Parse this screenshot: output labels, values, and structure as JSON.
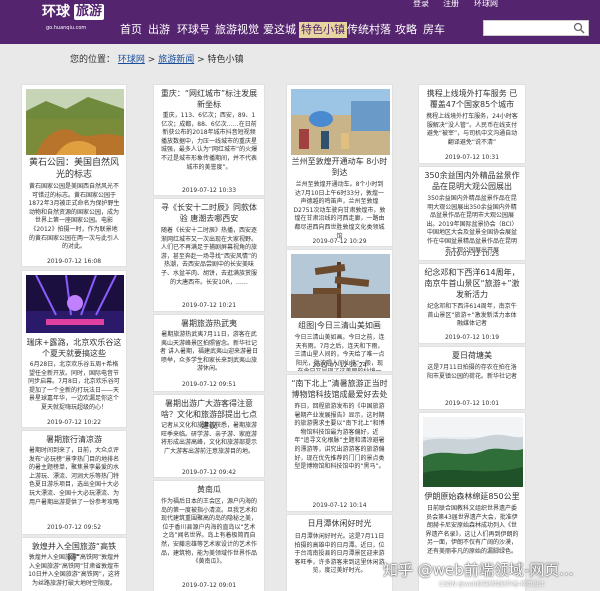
{
  "header": {
    "logo_text_1": "环球",
    "logo_text_2": "旅游",
    "logo_domain": "go.huanqiu.com",
    "user_links": [
      "登录",
      "注册",
      "环球网"
    ],
    "nav": [
      "首页",
      "出游",
      "环球号",
      "旅游视觉",
      "爱这城",
      "特色小镇",
      "传统村落",
      "攻略",
      "房车"
    ],
    "active_nav": "特色小镇",
    "search_value": ""
  },
  "breadcrumb": {
    "prefix": "您的位置：",
    "items": [
      "环球网",
      "旅游新闻",
      "特色小镇"
    ],
    "sep": ">"
  },
  "cards": [
    {
      "title": "黄石公园：美国自然风光的标志",
      "desc": "黄石国家公园是美国西自然风光不可错过的标志。黄石国家公园于1872年3月被正式命名为保护野生动物和自然资源的国家公园，成为世界上第一座国家公园。电影《2012》拍摄一时，作为联景地的黄石国家公园在两一次与此引人的对此。",
      "date": "2019-07-12 16:08"
    },
    {
      "title": "瑞床+露潞，北京欢乐谷这个夏天就要搞这些",
      "desc": "6月28日，北京欢乐谷五周+希格望任全新开放。同时，国际电音节同步启幕。7月8日，北京欢乐谷可提加了一个全新的打玩法日——天景星球嘉年华，一边欢漏足你这个夏天就捉嗨玩超级的心！",
      "date": "2019-07-12 10:22"
    },
    {
      "title": "暑期旅行清凉游",
      "desc": "暑期时间到来了，日前，大众点评发布“必玩榜”景李热门目的地排名的暑主题榜单，聚焦景李最爱的水上游玩、漂流、河涧大乐等热门特色夏日游乐项目，选出全国十大必玩大漂流、全国十大必玩漂流、为用户暑期出游提供了一份参考攻略",
      "date": "2019-07-12 09:52"
    },
    {
      "title": "敦煌并入全国旅游“高铁网”",
      "desc": "敦煌并入全国旅游“高铁网”敦煌并入全国旅游“高铁网”甘肃省敦煌市10日并入全国旅游“高铁网”，这将为丝路旅游打破大地时空限度。",
      "date": ""
    },
    {
      "title": "重庆：“网红城市”标注发展新坐标",
      "desc": "重庆，113、6亿次；西安，89、1亿次；成都，88、6亿次……在日前新获公布的2018年城市抖音短视频播放数据中，力压一线城市的重庆星城强，最多人认为“网红城市”的火爆不过是城市形象传播期间，并不代表城市的美誉度”。",
      "date": "2019-07-12 10:33"
    },
    {
      "title": "寻《长安十二时辰》同款体验 唐潮去哪西安",
      "desc": "随着《长安十二时辰》热播，西安逐渐网红城市又一次出现在大家视野。人们已不再满足于捕剧屏幕视角的旅游，甚至奔赴一场寻找“西安风情”的热潮，去西安品尝剧中的长安美味子、水盆羊肉、胡饼，去逛满族赏服的大唐西市。长安10R，……",
      "date": "2019-07-12 10:21"
    },
    {
      "title": "暑期旅游热武夷",
      "desc": "暑期旅游热武夷7月11日，游客在武夷山天游峰景区拍照留念。新华社记者 讲入暑期，福建武夷山迎来游暑日喷举，众多学生和家长来到武夷山旅游休闲。",
      "date": "2019-07-12 09:51"
    },
    {
      "title": "暑期出游广大游客得注意啥？文化和旅游部提出七点建议",
      "desc": "记者从文化和旅游部获悉，暑期旅游旺季来临。研学游、亲子游、家庭游将形成出游高峰，文化和旅游部提示广大游客出游前注意旅游目的地。",
      "date": "2019-07-12 09:42"
    },
    {
      "title": "黄南瓜",
      "desc": "作为福后日本的王会区，源户内海的岛的第一度被指小清流。旦我艺术和现代建筑重围聚高的岛的隐秘之美，位于香川县源户内海的直岛以“艺术之岛”闻名世界。岛上有着极简而自然，安藤忠雄等艺术家设计的艺术作品，建筑物，能为美领域作世界作品《黄南瓜》。",
      "date": "2019-07-12 09:01"
    },
    {
      "title": "兰州至敦煌开通动车 8小时到达",
      "desc": "兰州至敦煌开通动车。8个小时到达7月10日上午6时33分，敦煌一声德越的鸣笛声，兰州至敦煌D2751次动车驶向甘肃敦煌市，敦煌在甘肃沿线的河西走廊，一路由都尽进西向西世胜敦煌文化类领城馆",
      "date": "2019-07-12 10:29"
    },
    {
      "title": "组图|今日三清山美如画",
      "desc": "今日三清山美如画。今日之前，连天有雨。7月之后，连天和下雨，三清山星人间的，今天给了唯一点阳光，胜波唱人间仙境”一般，现在今日又呈现了这美丽的仙境一场，请你今日赴此5点至7点的三清山吧。",
      "date": "2019-07-12 10:24"
    },
    {
      "title": "“南下北上”清暑旅游正当时 博物馆科技馆成最爱好去处",
      "desc": "昨日，回程旅游发布的《中国旅游暑期产业发展报告》显示，这时期的旅游需求主要以“南下北上”和博物馆科技馆最为游客偏好，近年“追寻文化根脉”主题和清凉避暑的漂游等，讲究出游游客的旅游偏好，现在优先推荐的门门的景点类型是博物馆和科技馆中的“黑马”。",
      "date": "2019-07-12 10:14"
    },
    {
      "title": "日月潭休闲好时光",
      "desc": "日月潭休闲好时光。这是7月11日拍摄的高雄中的日月潭。近日，位于台湾南投县的日月潭景区迎来游客旺季，许多游客来到这里休闲游览，度过美好时光。",
      "date": ""
    },
    {
      "title": "携程上线境外打车服务 已覆盖47个国家85个城市",
      "desc": "携程上线境外打车服务，24小时客服解决“没人管”。人民币在线支付避免“被宰”，与司机中文沟通自动翻译避免“说不清”",
      "date": "2019-07-12 10:31"
    },
    {
      "title": "350余益国内外精品盆景作品在昆明大观公园展出",
      "desc": "350余益国内外精品盆景作品在昆明大观公园展出350余益国内外精品盆景作品在昆明市大观公园展出。2019年国际盆景协会（BCI）中国地区大会及盆景全国协会展盆作在中国盆景精品盆景作品在昆明市大观公园展出开展",
      "date": "2019-07-12 10:25"
    },
    {
      "title": "纪念邓和下西洋614周年，南京牛首山景区“旅游+”激发新活力",
      "desc": "纪念邓和下西洋614周年，南京牛首山景区“旅游+”激发新活力本体融媒体记者",
      "date": "2019-07-12 10:19"
    },
    {
      "title": "夏日荷塘美",
      "desc": "这是7月11日拍摄的存农在拍在洛阳市夏镇公园的荷花。新华社记者",
      "date": "2019-07-12 10:01"
    },
    {
      "title": "伊朗原始森林绵延850公里",
      "desc": "日前联合国教科文组织世界遗产委员会第43届世界遗产大会，批准伊朗赫卡尼安原始森林成功列入《世界遗产名录》，这让人们再到伊朗的另一面，伊朗不仅有广阔的沙漠，还有美丽非凡的原始的漏脚绿色。",
      "date": ""
    }
  ],
  "watermark": {
    "zhihu": "知乎 @web前端领域-网页...",
    "csdn": "CSDN @web前端领域创作者-网页设计"
  }
}
